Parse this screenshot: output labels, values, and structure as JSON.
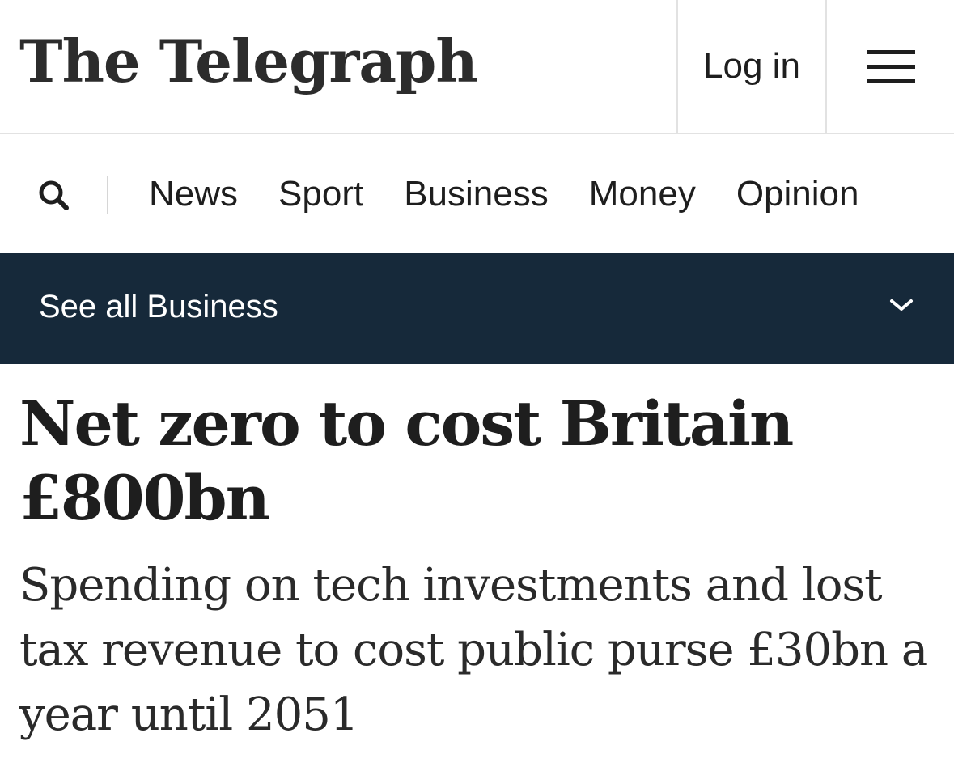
{
  "header": {
    "logo_text": "The Telegraph",
    "login_label": "Log in",
    "menu_icon": "hamburger-menu-icon"
  },
  "nav": {
    "search_icon": "search-icon",
    "items": [
      {
        "label": "News"
      },
      {
        "label": "Sport"
      },
      {
        "label": "Business"
      },
      {
        "label": "Money"
      },
      {
        "label": "Opinion"
      }
    ]
  },
  "section_bar": {
    "label": "See all Business",
    "icon": "chevron-down-icon",
    "background": "#16293a"
  },
  "article": {
    "headline": "Net zero to cost Britain £800bn",
    "standfirst": "Spending on tech investments and lost tax revenue to cost public purse £30bn a year until 2051"
  }
}
